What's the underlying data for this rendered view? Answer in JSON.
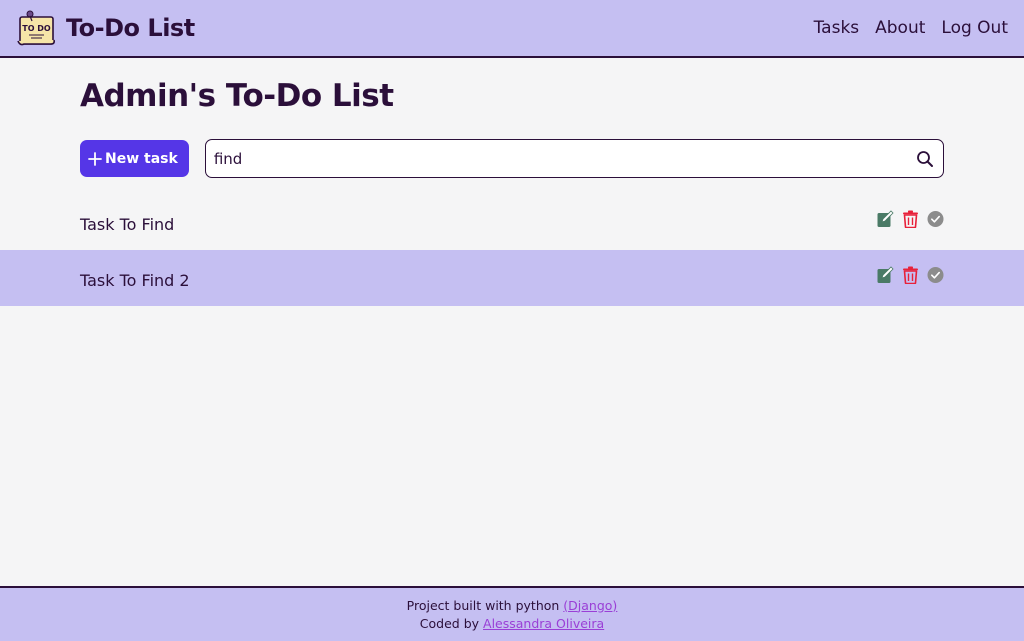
{
  "nav": {
    "logo_text": "TO DO",
    "title": "To-Do List",
    "links": [
      "Tasks",
      "About",
      "Log Out"
    ]
  },
  "page": {
    "title": "Admin's To-Do List"
  },
  "toolbar": {
    "new_task_label": "New task",
    "search_value": "find"
  },
  "tasks": [
    {
      "title": "Task To Find"
    },
    {
      "title": "Task To Find 2"
    }
  ],
  "footer": {
    "line1_text": "Project built with python ",
    "line1_link": "(Django)",
    "line2_text": "Coded by ",
    "line2_link": "Alessandra Oliveira"
  },
  "icons": {
    "edit": "edit-icon",
    "delete": "trash-icon",
    "complete": "check-circle-icon",
    "search": "search-icon",
    "add": "plus-icon"
  },
  "colors": {
    "nav_bg": "#c5bff2",
    "primary_button": "#5536e7",
    "text_dark": "#2b0f3a",
    "edit_green": "#4a7a66",
    "delete_red": "#e8213a",
    "complete_gray": "#8c8c8c",
    "link_purple": "#9a3fd6"
  }
}
